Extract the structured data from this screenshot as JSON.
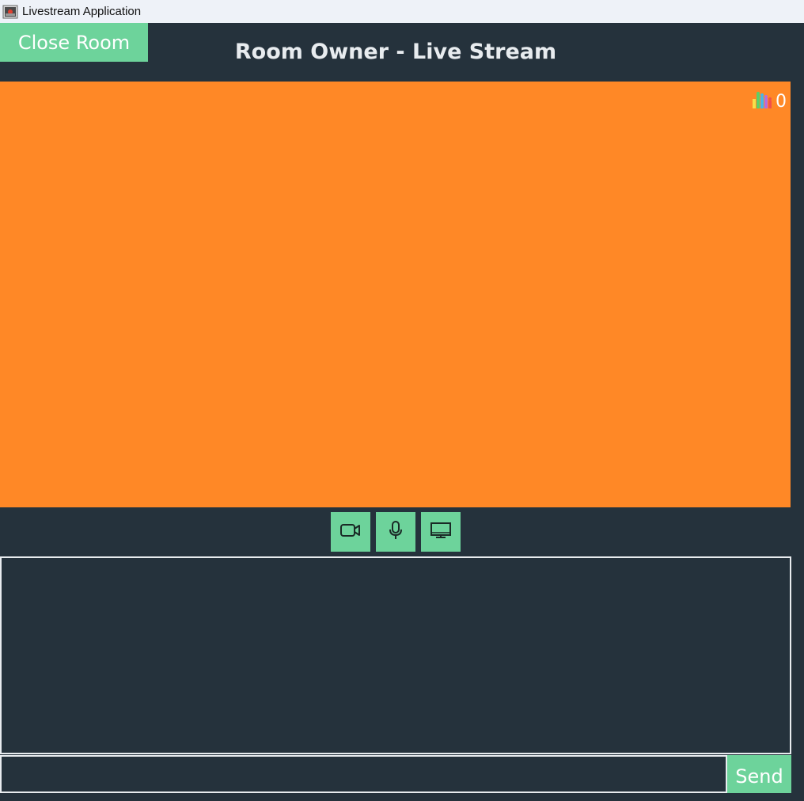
{
  "window": {
    "title": "Livestream Application",
    "icon": "app-icon"
  },
  "header": {
    "close_room_label": "Close Room",
    "title": "Room Owner - Live Stream"
  },
  "video": {
    "background_color": "#ff8826",
    "viewer_icon": "bar-chart-icon",
    "viewer_count": "0"
  },
  "controls": [
    {
      "name": "camera-button",
      "icon": "video-camera-icon"
    },
    {
      "name": "microphone-button",
      "icon": "microphone-icon"
    },
    {
      "name": "screen-share-button",
      "icon": "monitor-icon"
    }
  ],
  "chat": {
    "log_text": "",
    "input_value": "",
    "send_label": "Send"
  },
  "colors": {
    "background": "#25323c",
    "accent": "#6dd39b",
    "video": "#ff8826",
    "text": "#e8ecef"
  }
}
